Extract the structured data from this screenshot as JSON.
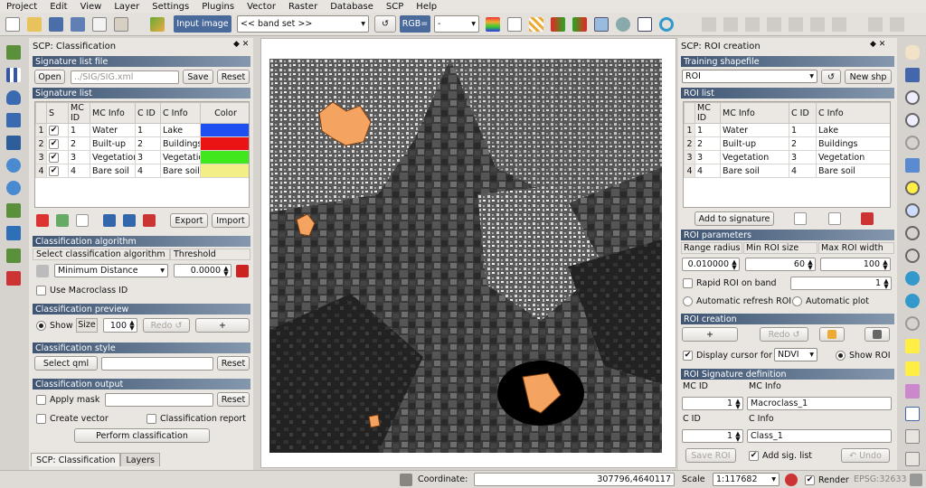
{
  "menu": [
    "Project",
    "Edit",
    "View",
    "Layer",
    "Settings",
    "Plugins",
    "Vector",
    "Raster",
    "Database",
    "SCP",
    "Help"
  ],
  "toolbar": {
    "input_image_label": "Input image",
    "band_set": "<< band set >>",
    "rgb_label": "RGB=",
    "rgb_value": "-"
  },
  "left_panel": {
    "title": "SCP: Classification",
    "signature_file": {
      "section": "Signature list file",
      "open": "Open",
      "path": "../SIG/SIG.xml",
      "save": "Save",
      "reset": "Reset"
    },
    "signature_list": {
      "section": "Signature list",
      "headers": [
        "S",
        "MC ID",
        "MC Info",
        "C ID",
        "C Info",
        "Color"
      ],
      "rows": [
        {
          "n": "1",
          "checked": "✔",
          "mc_id": "1",
          "mc_info": "Water",
          "c_id": "1",
          "c_info": "Lake",
          "color": "#1e4ff0"
        },
        {
          "n": "2",
          "checked": "✔",
          "mc_id": "2",
          "mc_info": "Built-up",
          "c_id": "2",
          "c_info": "Buildings",
          "color": "#ea1414"
        },
        {
          "n": "3",
          "checked": "✔",
          "mc_id": "3",
          "mc_info": "Vegetation",
          "c_id": "3",
          "c_info": "Vegetation",
          "color": "#3fe81c"
        },
        {
          "n": "4",
          "checked": "✔",
          "mc_id": "4",
          "mc_info": "Bare soil",
          "c_id": "4",
          "c_info": "Bare soil",
          "color": "#f4ee86"
        }
      ],
      "export": "Export",
      "import": "Import"
    },
    "algorithm": {
      "section": "Classification algorithm",
      "col1": "Select classification algorithm",
      "col2": "Threshold",
      "selected": "Minimum Distance",
      "threshold": "0.0000",
      "macroclass": "Use Macroclass ID"
    },
    "preview": {
      "section": "Classification preview",
      "show": "Show",
      "size_label": "Size",
      "size": "100",
      "redo": "Redo ↺",
      "plus": "+"
    },
    "style": {
      "section": "Classification style",
      "select_qml": "Select qml",
      "reset": "Reset"
    },
    "output": {
      "section": "Classification output",
      "apply_mask": "Apply mask",
      "reset": "Reset",
      "create_vector": "Create vector",
      "report": "Classification report",
      "perform": "Perform classification"
    },
    "tabs": [
      "SCP: Classification",
      "Layers"
    ]
  },
  "right_panel": {
    "title": "SCP: ROI creation",
    "shapefile": {
      "section": "Training shapefile",
      "selected": "ROI",
      "new_shp": "New shp"
    },
    "roi_list": {
      "section": "ROI list",
      "headers": [
        "MC ID",
        "MC Info",
        "C ID",
        "C Info"
      ],
      "rows": [
        {
          "n": "1",
          "mc_id": "1",
          "mc_info": "Water",
          "c_id": "1",
          "c_info": "Lake"
        },
        {
          "n": "2",
          "mc_id": "2",
          "mc_info": "Built-up",
          "c_id": "2",
          "c_info": "Buildings"
        },
        {
          "n": "3",
          "mc_id": "3",
          "mc_info": "Vegetation",
          "c_id": "3",
          "c_info": "Vegetation"
        },
        {
          "n": "4",
          "mc_id": "4",
          "mc_info": "Bare soil",
          "c_id": "4",
          "c_info": "Bare soil"
        }
      ],
      "add": "Add to signature"
    },
    "params": {
      "section": "ROI parameters",
      "h1": "Range radius",
      "h2": "Min ROI size",
      "h3": "Max ROI width",
      "v1": "0.010000",
      "v2": "60",
      "v3": "100",
      "rapid": "Rapid ROI on band",
      "band": "1",
      "auto_refresh": "Automatic refresh ROI",
      "auto_plot": "Automatic  plot"
    },
    "creation": {
      "section": "ROI creation",
      "plus": "+",
      "redo": "Redo ↺",
      "display_cursor": "Display cursor for",
      "index": "NDVI",
      "show_roi": "Show ROI"
    },
    "definition": {
      "section": "ROI Signature definition",
      "mc_id_label": "MC ID",
      "mc_info_label": "MC Info",
      "mc_id": "1",
      "mc_info": "Macroclass_1",
      "c_id_label": "C ID",
      "c_info_label": "C Info",
      "c_id": "1",
      "c_info": "Class_1",
      "save_roi": "Save ROI",
      "add_sig": "Add sig. list",
      "undo": "↶ Undo"
    }
  },
  "status": {
    "coordinate_label": "Coordinate:",
    "coordinate": "307796,4640117",
    "scale_label": "Scale",
    "scale": "1:117682",
    "render": "Render",
    "epsg": "EPSG:32633"
  }
}
